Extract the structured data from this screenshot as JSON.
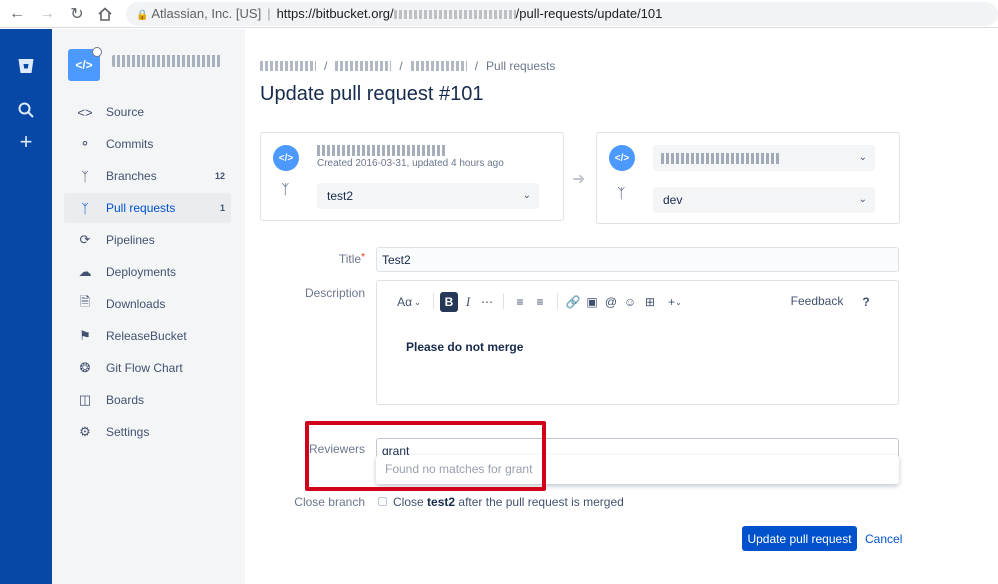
{
  "browser": {
    "site_owner": "Atlassian, Inc. [US]",
    "url": "https://bitbucket.org/…/pull-requests/update/101",
    "url_prefix": "https://bitbucket.org/",
    "url_suffix": "/pull-requests/update/101"
  },
  "sidebar": {
    "items": [
      {
        "label": "Source",
        "icon": "code-icon",
        "count": ""
      },
      {
        "label": "Commits",
        "icon": "commit-icon",
        "count": ""
      },
      {
        "label": "Branches",
        "icon": "branch-icon",
        "count": "12"
      },
      {
        "label": "Pull requests",
        "icon": "pull-request-icon",
        "count": "1"
      },
      {
        "label": "Pipelines",
        "icon": "pipelines-icon",
        "count": ""
      },
      {
        "label": "Deployments",
        "icon": "cloud-upload-icon",
        "count": ""
      },
      {
        "label": "Downloads",
        "icon": "file-icon",
        "count": ""
      },
      {
        "label": "ReleaseBucket",
        "icon": "tag-icon",
        "count": ""
      },
      {
        "label": "Git Flow Chart",
        "icon": "gitflow-icon",
        "count": ""
      },
      {
        "label": "Boards",
        "icon": "board-icon",
        "count": ""
      },
      {
        "label": "Settings",
        "icon": "gear-icon",
        "count": ""
      }
    ]
  },
  "breadcrumb": {
    "last": "Pull requests"
  },
  "page_title": "Update pull request #101",
  "source": {
    "meta": "Created 2016-03-31, updated 4 hours ago",
    "branch": "test2"
  },
  "destination": {
    "branch": "dev"
  },
  "form": {
    "title_label": "Title",
    "title_value": "Test2",
    "description_label": "Description",
    "toolbar": {
      "text_style": "Aα",
      "feedback": "Feedback",
      "help": "?"
    },
    "description_content": "Please do not merge",
    "reviewers_label": "Reviewers",
    "reviewers_value": "grant",
    "reviewers_no_match": "Found no matches for grant",
    "close_branch_label": "Close branch",
    "close_prefix": "Close",
    "close_branch_name": "test2",
    "close_suffix": "after the pull request is merged",
    "submit_label": "Update pull request",
    "cancel_label": "Cancel"
  },
  "colors": {
    "primary": "#0052cc",
    "global_nav": "#0747a6",
    "highlight": "#d0021b"
  }
}
